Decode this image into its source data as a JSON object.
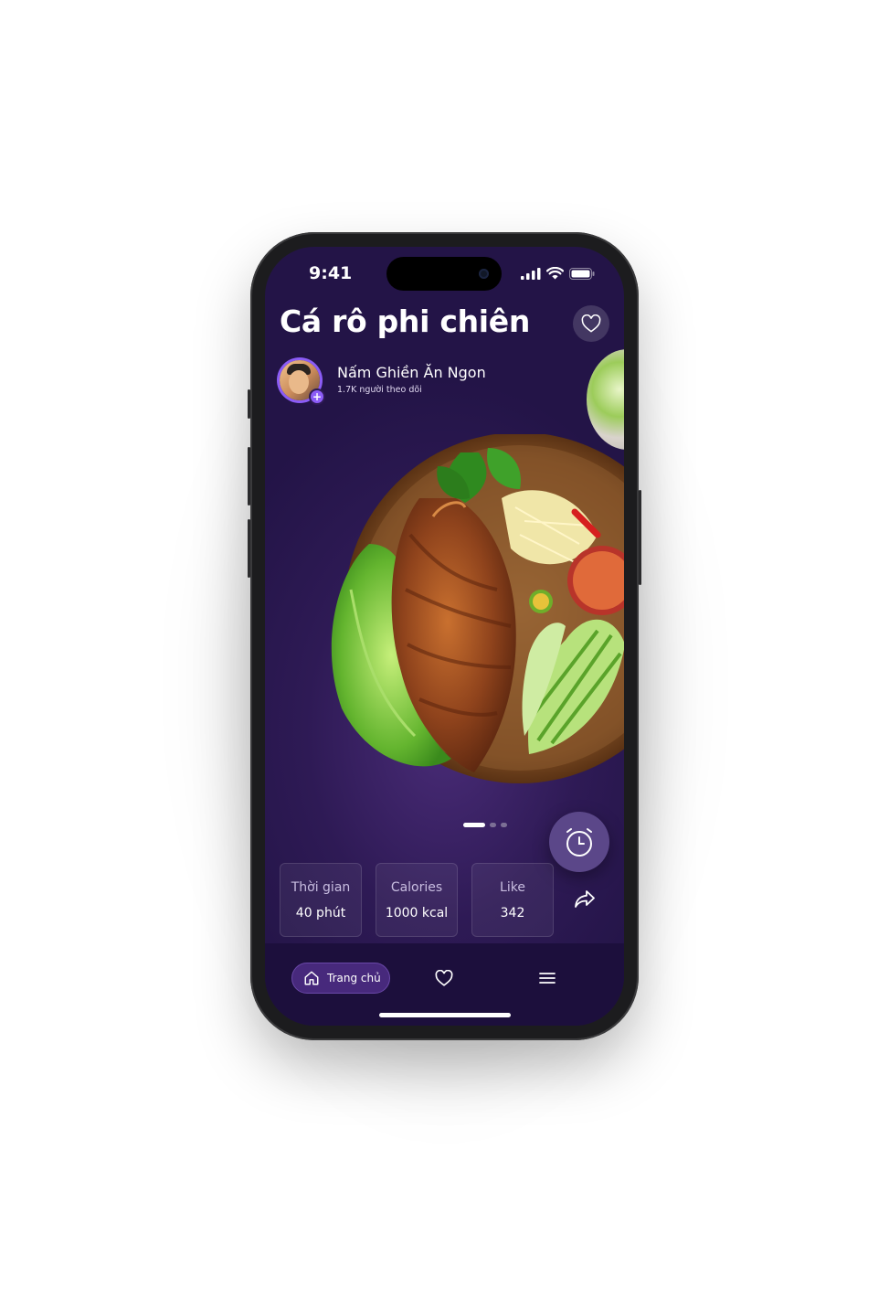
{
  "status_bar": {
    "time": "9:41"
  },
  "recipe": {
    "title": "Cá rô phi chiên",
    "author_name": "Nấm Ghiền Ăn Ngon",
    "followers": "1.7K người theo dõi"
  },
  "carousel": {
    "pages": 3,
    "active_index": 0
  },
  "stats": [
    {
      "label": "Thời gian",
      "value": "40 phút"
    },
    {
      "label": "Calories",
      "value": "1000 kcal"
    },
    {
      "label": "Like",
      "value": "342"
    }
  ],
  "nav": {
    "home_label": "Trang chủ"
  },
  "colors": {
    "background": "#2e1a55",
    "accent": "#8b5cf6",
    "nav_active": "#47297c"
  },
  "icons": [
    "heart-icon",
    "timer-icon",
    "share-icon",
    "home-icon",
    "menu-icon",
    "signal-icon",
    "wifi-icon",
    "battery-icon"
  ]
}
